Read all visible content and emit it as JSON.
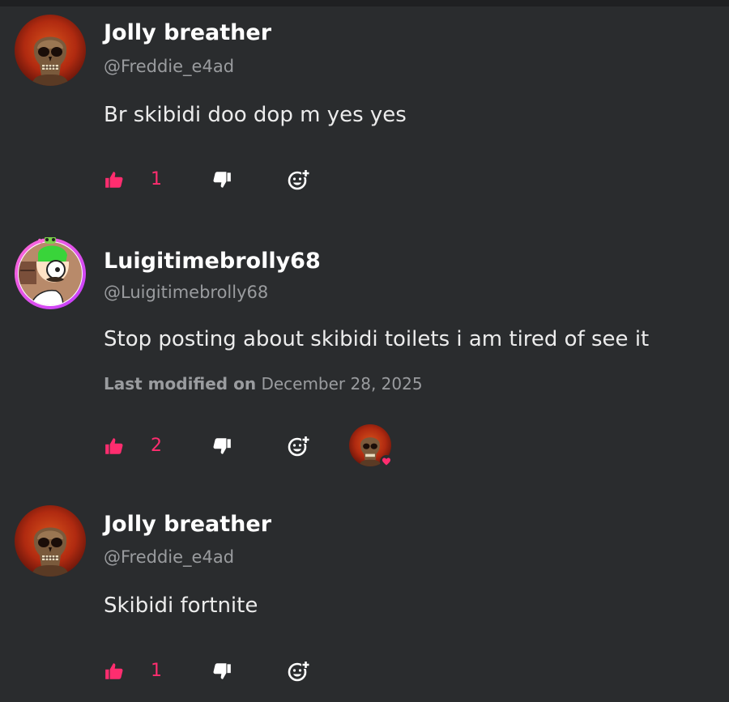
{
  "comments": [
    {
      "display_name": "Jolly breather",
      "handle": "@Freddie_e4ad",
      "text": "Br skibidi doo dop m yes yes",
      "like_count": "1",
      "avatar_icon": "skull-avatar-icon"
    },
    {
      "display_name": "Luigitimebrolly68",
      "handle": "@Luigitimebrolly68",
      "text": "Stop posting about skibidi toilets i am tired of see it",
      "modified_label": "Last modified on",
      "modified_date": "December 28, 2025",
      "like_count": "2",
      "avatar_icon": "cartoon-character-avatar-icon"
    },
    {
      "display_name": "Jolly breather",
      "handle": "@Freddie_e4ad",
      "text": "Skibidi fortnite",
      "like_count": "1",
      "avatar_icon": "skull-avatar-icon"
    }
  ],
  "colors": {
    "background": "#2a2c2e",
    "accent_pink": "#ff2d6f",
    "muted_text": "#9a9c9f"
  },
  "icons": {
    "like": "thumbs-up-icon",
    "dislike": "thumbs-down-icon",
    "react": "add-reaction-icon",
    "reaction_heart": "heart-icon"
  }
}
